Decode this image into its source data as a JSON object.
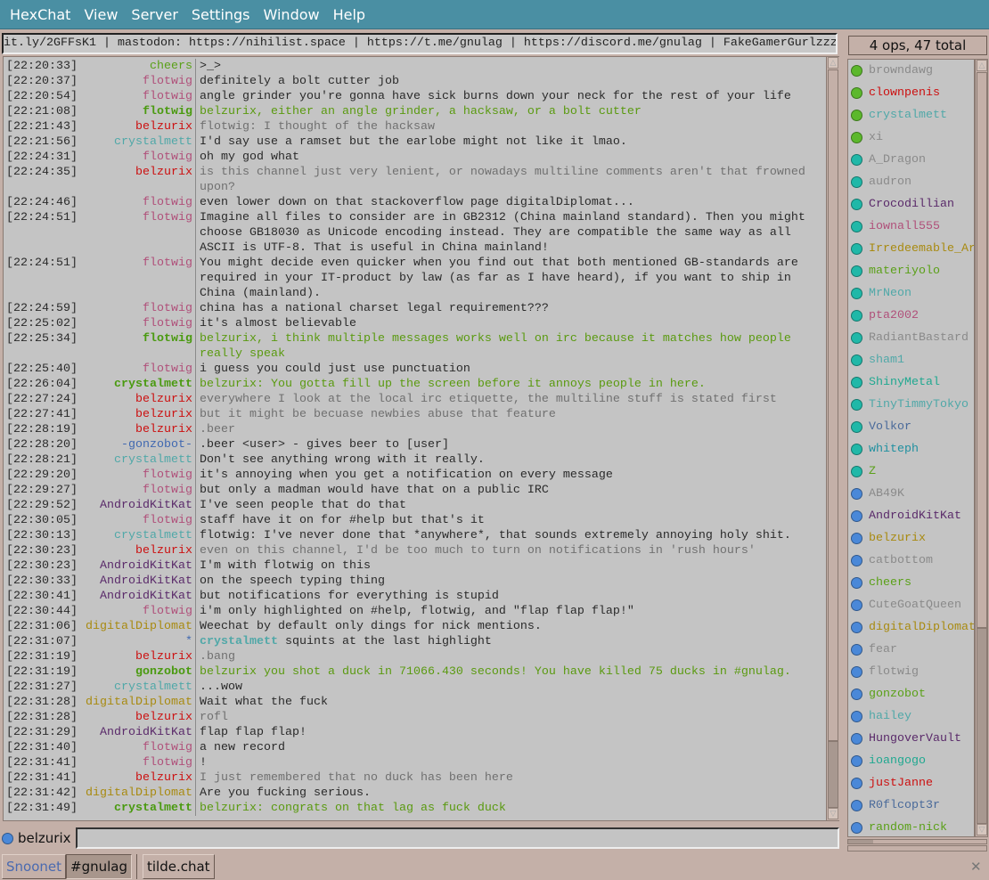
{
  "menu": [
    "HexChat",
    "View",
    "Server",
    "Settings",
    "Window",
    "Help"
  ],
  "topic": "it.ly/2GFFsK1 | mastodon: https://nihilist.space | https://t.me/gnulag | https://discord.me/gnulag | FakeGamerGurlzzz",
  "user_count": "4 ops, 47 total",
  "colors": {
    "flotwig": "#b0507a",
    "belzurix": "#cc1010",
    "crystalmett": "#50a8a8",
    "cheers": "#5aa018",
    "AndroidKitKat": "#5a2a6a",
    "digitalDiplomat": "#a88a10",
    "gonzobot": "#4a9a10",
    "-gonzobot-": "#4068b0",
    "*": "#4068b0"
  },
  "lines": [
    {
      "time": "[22:20:33]",
      "nick": "cheers",
      "text": ">_>",
      "style": ""
    },
    {
      "time": "[22:20:37]",
      "nick": "flotwig",
      "text": "definitely a bolt cutter job",
      "style": ""
    },
    {
      "time": "[22:20:54]",
      "nick": "flotwig",
      "text": "angle grinder you're gonna have sick burns down your neck for the rest of your life",
      "style": ""
    },
    {
      "time": "[22:21:08]",
      "nick": "flotwig",
      "text": "belzurix, either an angle grinder, a hacksaw, or a bolt cutter",
      "style": "hl",
      "nickcolor": "#4a9a10"
    },
    {
      "time": "[22:21:43]",
      "nick": "belzurix",
      "text": "flotwig: I thought of the hacksaw",
      "style": "self"
    },
    {
      "time": "[22:21:56]",
      "nick": "crystalmett",
      "text": "I'd say use a ramset but the earlobe might not like it lmao.",
      "style": ""
    },
    {
      "time": "[22:24:31]",
      "nick": "flotwig",
      "text": "oh my god what",
      "style": ""
    },
    {
      "time": "[22:24:35]",
      "nick": "belzurix",
      "text": "is this channel just very lenient, or nowadays multiline comments aren't that frowned upon?",
      "style": "self"
    },
    {
      "time": "[22:24:46]",
      "nick": "flotwig",
      "text": "even lower down on that stackoverflow page digitalDiplomat...",
      "style": ""
    },
    {
      "time": "[22:24:51]",
      "nick": "flotwig",
      "text": "Imagine all files to consider are in GB2312 (China mainland standard). Then you might choose GB18030 as Unicode encoding instead. They are compatible the same way as all ASCII is UTF-8. That is useful in China mainland!",
      "style": ""
    },
    {
      "time": "[22:24:51]",
      "nick": "flotwig",
      "text": "You might decide even quicker when you find out that both mentioned GB-standards are required in your IT-product by law (as far as I have heard), if you want to ship in China (mainland).",
      "style": ""
    },
    {
      "time": "[22:24:59]",
      "nick": "flotwig",
      "text": "china has a national charset legal requirement???",
      "style": ""
    },
    {
      "time": "[22:25:02]",
      "nick": "flotwig",
      "text": "it's almost believable",
      "style": ""
    },
    {
      "time": "[22:25:34]",
      "nick": "flotwig",
      "text": "belzurix, i think multiple messages works well on irc because it matches how people really speak",
      "style": "hl",
      "nickcolor": "#4a9a10"
    },
    {
      "time": "[22:25:40]",
      "nick": "flotwig",
      "text": "i guess you could just use punctuation",
      "style": ""
    },
    {
      "time": "[22:26:04]",
      "nick": "crystalmett",
      "text": "belzurix: You gotta fill up the screen before it annoys people in here.",
      "style": "hl",
      "nickcolor": "#4a9a10"
    },
    {
      "time": "[22:27:24]",
      "nick": "belzurix",
      "text": "everywhere I look at the local irc etiquette, the multiline stuff is stated first",
      "style": "self"
    },
    {
      "time": "[22:27:41]",
      "nick": "belzurix",
      "text": "but it might be becuase newbies abuse that feature",
      "style": "self"
    },
    {
      "time": "[22:28:19]",
      "nick": "belzurix",
      "text": ".beer",
      "style": "self"
    },
    {
      "time": "[22:28:20]",
      "nick": "-gonzobot-",
      "text": ".beer <user> - gives beer to [user]",
      "style": ""
    },
    {
      "time": "[22:28:21]",
      "nick": "crystalmett",
      "text": "Don't see anything wrong with it really.",
      "style": ""
    },
    {
      "time": "[22:29:20]",
      "nick": "flotwig",
      "text": "it's annoying when you get a notification on every message",
      "style": ""
    },
    {
      "time": "[22:29:27]",
      "nick": "flotwig",
      "text": "but only a madman would have that on a public IRC",
      "style": ""
    },
    {
      "time": "[22:29:52]",
      "nick": "AndroidKitKat",
      "text": "I've seen people that do that",
      "style": ""
    },
    {
      "time": "[22:30:05]",
      "nick": "flotwig",
      "text": "staff have it on for #help but that's it",
      "style": ""
    },
    {
      "time": "[22:30:13]",
      "nick": "crystalmett",
      "text": "flotwig: I've never done that *anywhere*, that sounds extremely annoying holy shit.",
      "style": ""
    },
    {
      "time": "[22:30:23]",
      "nick": "belzurix",
      "text": "even on this channel, I'd be too much to turn on notifications in 'rush hours'",
      "style": "self"
    },
    {
      "time": "[22:30:23]",
      "nick": "AndroidKitKat",
      "text": "I'm with flotwig on this",
      "style": ""
    },
    {
      "time": "[22:30:33]",
      "nick": "AndroidKitKat",
      "text": "on the speech typing thing",
      "style": ""
    },
    {
      "time": "[22:30:41]",
      "nick": "AndroidKitKat",
      "text": "but notifications for everything is stupid",
      "style": ""
    },
    {
      "time": "[22:30:44]",
      "nick": "flotwig",
      "text": "i'm only highlighted on #help, flotwig, and \"flap flap flap!\"",
      "style": ""
    },
    {
      "time": "[22:31:06]",
      "nick": "digitalDiplomat",
      "text": "Weechat by default only dings for nick mentions.",
      "style": ""
    },
    {
      "time": "[22:31:07]",
      "nick": "*",
      "action_nick": "crystalmett",
      "text": "squints at the last highlight",
      "style": "action"
    },
    {
      "time": "[22:31:19]",
      "nick": "belzurix",
      "text": ".bang",
      "style": "self"
    },
    {
      "time": "[22:31:19]",
      "nick": "gonzobot",
      "text": "belzurix you shot a duck in 71066.430 seconds! You have killed 75 ducks in #gnulag.",
      "style": "hl",
      "nickcolor": "#4a9a10"
    },
    {
      "time": "[22:31:27]",
      "nick": "crystalmett",
      "text": "...wow",
      "style": ""
    },
    {
      "time": "[22:31:28]",
      "nick": "digitalDiplomat",
      "text": "Wait what the fuck",
      "style": ""
    },
    {
      "time": "[22:31:28]",
      "nick": "belzurix",
      "text": "rofl",
      "style": "self"
    },
    {
      "time": "[22:31:29]",
      "nick": "AndroidKitKat",
      "text": "flap flap flap!",
      "style": ""
    },
    {
      "time": "[22:31:40]",
      "nick": "flotwig",
      "text": "a new record",
      "style": ""
    },
    {
      "time": "[22:31:41]",
      "nick": "flotwig",
      "text": "!",
      "style": ""
    },
    {
      "time": "[22:31:41]",
      "nick": "belzurix",
      "text": "I just remembered that no duck has been here",
      "style": "self"
    },
    {
      "time": "[22:31:42]",
      "nick": "digitalDiplomat",
      "text": "Are you fucking serious.",
      "style": ""
    },
    {
      "time": "[22:31:49]",
      "nick": "crystalmett",
      "text": "belzurix: congrats on that lag as fuck duck",
      "style": "hl",
      "nickcolor": "#4a9a10"
    }
  ],
  "users": [
    {
      "name": "browndawg",
      "dot": "#5cb82c",
      "color": "#8a8a8a"
    },
    {
      "name": "clownpenis",
      "dot": "#5cb82c",
      "color": "#cc1010"
    },
    {
      "name": "crystalmett",
      "dot": "#5cb82c",
      "color": "#50a8a8"
    },
    {
      "name": "xi",
      "dot": "#5cb82c",
      "color": "#8a8a8a"
    },
    {
      "name": "A_Dragon",
      "dot": "#20b8a8",
      "color": "#8a8a8a"
    },
    {
      "name": "audron",
      "dot": "#20b8a8",
      "color": "#8a8a8a"
    },
    {
      "name": "Crocodillian",
      "dot": "#20b8a8",
      "color": "#5a2a6a"
    },
    {
      "name": "iownall555",
      "dot": "#20b8a8",
      "color": "#b0507a"
    },
    {
      "name": "Irredeemable_Ar",
      "dot": "#20b8a8",
      "color": "#a88a10"
    },
    {
      "name": "materiyolo",
      "dot": "#20b8a8",
      "color": "#5aa018"
    },
    {
      "name": "MrNeon",
      "dot": "#20b8a8",
      "color": "#50a8a8"
    },
    {
      "name": "pta2002",
      "dot": "#20b8a8",
      "color": "#b0507a"
    },
    {
      "name": "RadiantBastard",
      "dot": "#20b8a8",
      "color": "#8a8a8a"
    },
    {
      "name": "sham1",
      "dot": "#20b8a8",
      "color": "#50a8a8"
    },
    {
      "name": "ShinyMetal",
      "dot": "#20b8a8",
      "color": "#20a890"
    },
    {
      "name": "TinyTimmyTokyo",
      "dot": "#20b8a8",
      "color": "#50a8a8"
    },
    {
      "name": "Volkor",
      "dot": "#20b8a8",
      "color": "#4a6a9a"
    },
    {
      "name": "whiteph",
      "dot": "#20b8a8",
      "color": "#2090a0"
    },
    {
      "name": "Z",
      "dot": "#20b8a8",
      "color": "#5aa018"
    },
    {
      "name": "AB49K",
      "dot": "#4a88d8",
      "color": "#8a8a8a"
    },
    {
      "name": "AndroidKitKat",
      "dot": "#4a88d8",
      "color": "#5a2a6a"
    },
    {
      "name": "belzurix",
      "dot": "#4a88d8",
      "color": "#a88a10"
    },
    {
      "name": "catbottom",
      "dot": "#4a88d8",
      "color": "#8a8a8a"
    },
    {
      "name": "cheers",
      "dot": "#4a88d8",
      "color": "#5aa018"
    },
    {
      "name": "CuteGoatQueen",
      "dot": "#4a88d8",
      "color": "#8a8a8a"
    },
    {
      "name": "digitalDiplomat",
      "dot": "#4a88d8",
      "color": "#a88a10"
    },
    {
      "name": "fear",
      "dot": "#4a88d8",
      "color": "#8a8a8a"
    },
    {
      "name": "flotwig",
      "dot": "#4a88d8",
      "color": "#8a8a8a"
    },
    {
      "name": "gonzobot",
      "dot": "#4a88d8",
      "color": "#5aa018"
    },
    {
      "name": "hailey",
      "dot": "#4a88d8",
      "color": "#50a8a8"
    },
    {
      "name": "HungoverVault",
      "dot": "#4a88d8",
      "color": "#5a2a6a"
    },
    {
      "name": "ioangogo",
      "dot": "#4a88d8",
      "color": "#20a890"
    },
    {
      "name": "justJanne",
      "dot": "#4a88d8",
      "color": "#cc1010"
    },
    {
      "name": "R0flcopt3r",
      "dot": "#4a88d8",
      "color": "#4a6a9a"
    },
    {
      "name": "random-nick",
      "dot": "#4a88d8",
      "color": "#5aa018"
    }
  ],
  "input": {
    "nick": "belzurix",
    "value": ""
  },
  "tabs": {
    "network": "Snoonet",
    "channel": "#gnulag",
    "other": "tilde.chat"
  },
  "close_label": "✕"
}
